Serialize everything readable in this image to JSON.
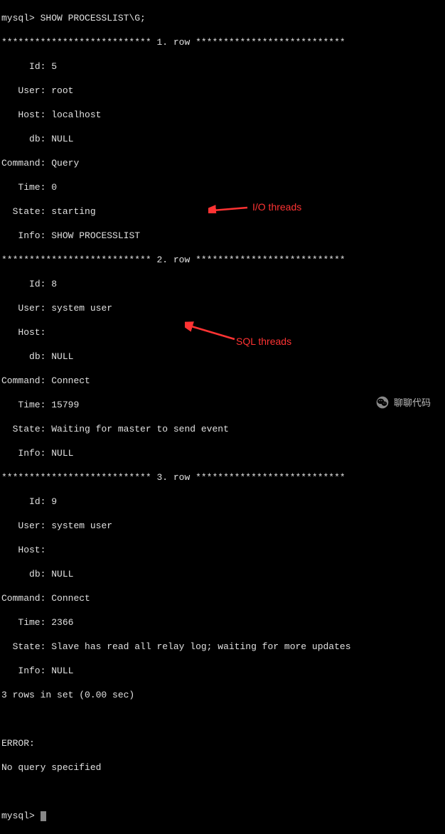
{
  "prompt": "mysql>",
  "command": "SHOW PROCESSLIST\\G;",
  "row_separator_prefix": "***************************",
  "row_separator_suffix": "***************************",
  "row_label_1": "1. row",
  "row_label_2": "2. row",
  "row_label_3": "3. row",
  "fields": {
    "id": "Id:",
    "user": "User:",
    "host": "Host:",
    "db": "db:",
    "command": "Command:",
    "time": "Time:",
    "state": "State:",
    "info": "Info:"
  },
  "rows": [
    {
      "id": "5",
      "user": "root",
      "host": "localhost",
      "db": "NULL",
      "command": "Query",
      "time": "0",
      "state": "starting",
      "info": "SHOW PROCESSLIST"
    },
    {
      "id": "8",
      "user": "system user",
      "host": "",
      "db": "NULL",
      "command": "Connect",
      "time": "15799",
      "state": "Waiting for master to send event",
      "info": "NULL"
    },
    {
      "id": "9",
      "user": "system user",
      "host": "",
      "db": "NULL",
      "command": "Connect",
      "time": "2366",
      "state": "Slave has read all relay log; waiting for more updates",
      "info": "NULL"
    }
  ],
  "summary": "3 rows in set (0.00 sec)",
  "error_label": "ERROR:",
  "error_text": "No query specified",
  "annotations": {
    "io": "I/O threads",
    "sql": "SQL threads"
  },
  "watermark": "聊聊代码"
}
